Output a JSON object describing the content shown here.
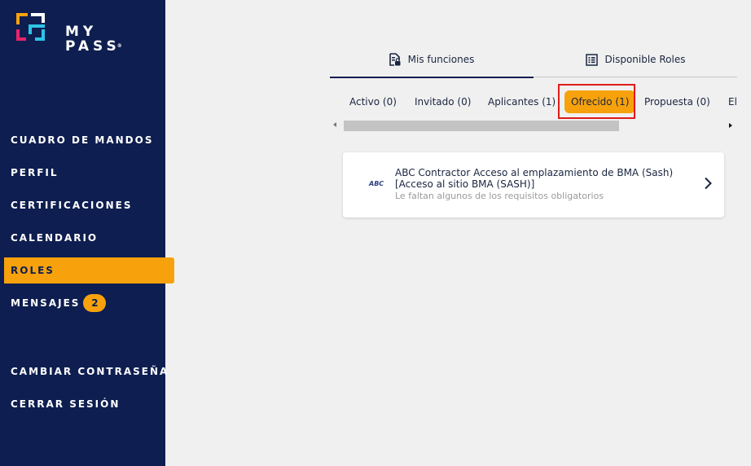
{
  "brand": {
    "name_line1": "MY",
    "name_line2": "PASS",
    "reg": "®"
  },
  "sidebar": {
    "items": [
      {
        "label": "CUADRO DE MANDOS"
      },
      {
        "label": "PERFIL"
      },
      {
        "label": "CERTIFICACIONES"
      },
      {
        "label": "CALENDARIO"
      },
      {
        "label": "ROLES",
        "active": true
      },
      {
        "label": "MENSAJES",
        "badge": "2"
      },
      {
        "label": "CAMBIAR CONTRASEÑA"
      },
      {
        "label": "CERRAR SESIÓN"
      }
    ]
  },
  "top_tabs": [
    {
      "label": "Mis funciones",
      "icon": "document-lock-icon",
      "active": true
    },
    {
      "label": "Disponible Roles",
      "icon": "list-icon",
      "active": false
    }
  ],
  "sub_tabs": [
    {
      "label": "Activo (0)"
    },
    {
      "label": "Invitado (0)"
    },
    {
      "label": "Aplicantes (1)"
    },
    {
      "label": "Ofrecido (1)",
      "active": true
    },
    {
      "label": "Propuesta (0)"
    },
    {
      "label": "El"
    }
  ],
  "role_card": {
    "logo": "ABC",
    "title": "ABC Contractor Acceso al emplazamiento de BMA (Sash) [Acceso al sitio BMA (SASH)]",
    "subtitle": "Le faltan algunos de los requisitos obligatorios"
  },
  "colors": {
    "sidebar": "#0e1e50",
    "accent": "#f7a20c",
    "highlight": "#e01b1b"
  }
}
